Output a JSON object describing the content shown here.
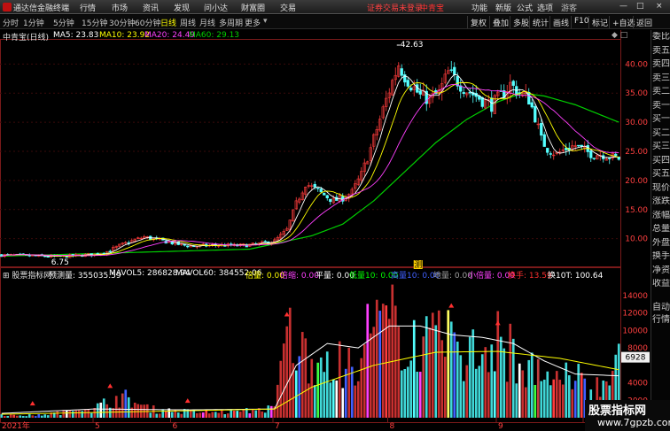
{
  "titlebar": {
    "app_name": "通达信金融终端",
    "menu": [
      "行情",
      "市场",
      "资讯",
      "发现",
      "问小达",
      "财富圈",
      "交易"
    ],
    "notice": "证券交易未登录",
    "stock_name": "中青宝",
    "right_menu": [
      "功能",
      "新版",
      "公式",
      "选项"
    ],
    "guest": "游客",
    "controls": [
      "—",
      "□",
      "×"
    ],
    "colors": {
      "notice": "#ff4040",
      "stock": "#ff3030"
    }
  },
  "toolbar": {
    "periods": [
      "分时",
      "1分钟",
      "5分钟",
      "15分钟",
      "30分钟",
      "60分钟",
      "日线",
      "周线",
      "月线",
      "多周期",
      "更多"
    ],
    "active_period": "日线",
    "tools": [
      "复权",
      "叠加",
      "多股",
      "统计",
      "画线",
      "F10",
      "标记",
      "+自选",
      "返回"
    ]
  },
  "price_panel": {
    "stock_label": "中青宝(日线)",
    "ma_legend": [
      {
        "label": "MA5: 23.83",
        "color": "#ffffff"
      },
      {
        "label": "MA10: 23.92",
        "color": "#ffff00"
      },
      {
        "label": "MA20: 24.49",
        "color": "#ff40ff"
      },
      {
        "label": "MA60: 29.13",
        "color": "#00d000"
      }
    ],
    "y_ticks": [
      "40.00",
      "35.00",
      "30.00",
      "25.00",
      "20.00",
      "15.00",
      "10.00"
    ],
    "high_label": "42.63",
    "low_label": "6.75",
    "marker_label": "测"
  },
  "volume_panel": {
    "title": "股票指标网",
    "legend": [
      {
        "label": "预测量: 355035.59",
        "color": "#ffffff"
      },
      {
        "label": "MAVOL5: 286828.94",
        "color": "#ffffff"
      },
      {
        "label": "MAVOL60: 384552.06",
        "color": "#ffffff"
      },
      {
        "label": "倍量: 0.00",
        "color": "#ffff00"
      },
      {
        "label": "倍缩: 0.00",
        "color": "#ff40ff"
      },
      {
        "label": "平量: 0.00",
        "color": "#ffffff"
      },
      {
        "label": "低量10: 0.00",
        "color": "#00ff00"
      },
      {
        "label": "高量10: 0.00",
        "color": "#4060ff"
      },
      {
        "label": "地量: 0.00",
        "color": "#a0a0a0"
      },
      {
        "label": "小倍量: 0.00",
        "color": "#ff40ff"
      },
      {
        "label": "换手: 13.59",
        "color": "#ff3030"
      },
      {
        "label": "换10T: 100.64",
        "color": "#ffffff"
      }
    ],
    "y_ticks": [
      "14000",
      "12000",
      "10000",
      "8000",
      "4000",
      "2000"
    ],
    "current_tag": "6928",
    "x_labels": [
      "2021年",
      "5",
      "6",
      "7",
      "8",
      "9",
      "10",
      "11",
      "12",
      "2",
      "3"
    ]
  },
  "sidebar": {
    "items": [
      "委比",
      "卖五",
      "卖四",
      "卖三",
      "卖二",
      "卖一",
      "买一",
      "买二",
      "买三",
      "买四",
      "买五",
      "现价",
      "涨跌",
      "涨幅",
      "总量",
      "外盘",
      "换手",
      "净资",
      "收益"
    ],
    "bottom": [
      "自动",
      "行情"
    ]
  },
  "watermark": {
    "line1": "股票指标网",
    "line2": "www.7gpzb.com"
  },
  "chart_data": {
    "type": "candlestick",
    "title": "中青宝(日线)",
    "price_ylim": [
      6,
      44
    ],
    "notable": {
      "high": 42.63,
      "low": 6.75
    },
    "price_path": [
      [
        0,
        7.2
      ],
      [
        6,
        7.1
      ],
      [
        12,
        7.0
      ],
      [
        18,
        6.9
      ],
      [
        24,
        7.1
      ],
      [
        30,
        7.3
      ],
      [
        34,
        7.8
      ],
      [
        38,
        8.8
      ],
      [
        42,
        9.6
      ],
      [
        46,
        10.3
      ],
      [
        50,
        9.8
      ],
      [
        54,
        9.4
      ],
      [
        58,
        8.9
      ],
      [
        62,
        8.7
      ],
      [
        66,
        8.8
      ],
      [
        70,
        8.9
      ],
      [
        76,
        8.8
      ],
      [
        82,
        9.0
      ],
      [
        88,
        9.6
      ],
      [
        92,
        11.5
      ],
      [
        95,
        16.0
      ],
      [
        98,
        19.5
      ],
      [
        101,
        18.5
      ],
      [
        104,
        17.5
      ],
      [
        107,
        16.5
      ],
      [
        110,
        17.0
      ],
      [
        113,
        18.0
      ],
      [
        116,
        21.0
      ],
      [
        119,
        25.5
      ],
      [
        122,
        30.5
      ],
      [
        125,
        35.5
      ],
      [
        128,
        40.0
      ],
      [
        130,
        38.0
      ],
      [
        132,
        36.5
      ],
      [
        135,
        34.5
      ],
      [
        138,
        34.0
      ],
      [
        141,
        35.0
      ],
      [
        144,
        38.5
      ],
      [
        147,
        37.0
      ],
      [
        150,
        35.5
      ],
      [
        153,
        34.5
      ],
      [
        156,
        33.5
      ],
      [
        158,
        33.0
      ],
      [
        161,
        34.5
      ],
      [
        164,
        36.5
      ],
      [
        167,
        35.0
      ],
      [
        170,
        34.0
      ],
      [
        172,
        31.0
      ],
      [
        174,
        27.0
      ],
      [
        176,
        25.5
      ],
      [
        179,
        24.5
      ],
      [
        182,
        25.5
      ],
      [
        185,
        26.0
      ],
      [
        188,
        25.0
      ],
      [
        191,
        24.5
      ],
      [
        194,
        24.5
      ],
      [
        197,
        24.0
      ],
      [
        199,
        23.8
      ]
    ],
    "ma60_path": [
      [
        0,
        7.0
      ],
      [
        40,
        7.6
      ],
      [
        80,
        8.2
      ],
      [
        100,
        10.5
      ],
      [
        110,
        12.5
      ],
      [
        120,
        16.5
      ],
      [
        130,
        21.5
      ],
      [
        140,
        26.5
      ],
      [
        150,
        30.5
      ],
      [
        160,
        33.5
      ],
      [
        168,
        35.0
      ],
      [
        175,
        34.5
      ],
      [
        185,
        33.0
      ],
      [
        199,
        30.0
      ]
    ],
    "volume_ylim": [
      0,
      15000
    ],
    "volume_profile": [
      [
        0,
        400
      ],
      [
        10,
        300
      ],
      [
        20,
        700
      ],
      [
        30,
        1200
      ],
      [
        35,
        2200
      ],
      [
        40,
        2800
      ],
      [
        45,
        1500
      ],
      [
        50,
        1000
      ],
      [
        60,
        800
      ],
      [
        70,
        700
      ],
      [
        80,
        900
      ],
      [
        88,
        1200
      ],
      [
        92,
        11000
      ],
      [
        95,
        9500
      ],
      [
        100,
        8500
      ],
      [
        105,
        6000
      ],
      [
        110,
        7000
      ],
      [
        115,
        8500
      ],
      [
        120,
        11500
      ],
      [
        125,
        12500
      ],
      [
        130,
        11000
      ],
      [
        135,
        10500
      ],
      [
        140,
        9000
      ],
      [
        145,
        12000
      ],
      [
        150,
        8000
      ],
      [
        155,
        9000
      ],
      [
        160,
        10000
      ],
      [
        165,
        8500
      ],
      [
        170,
        6000
      ],
      [
        175,
        5000
      ],
      [
        180,
        4500
      ],
      [
        185,
        5500
      ],
      [
        190,
        3500
      ],
      [
        195,
        4500
      ],
      [
        199,
        6928
      ]
    ],
    "mavol_path": [
      [
        0,
        500
      ],
      [
        30,
        1000
      ],
      [
        60,
        900
      ],
      [
        88,
        1000
      ],
      [
        95,
        6000
      ],
      [
        105,
        8500
      ],
      [
        115,
        8000
      ],
      [
        125,
        10500
      ],
      [
        135,
        10500
      ],
      [
        145,
        9500
      ],
      [
        155,
        9200
      ],
      [
        165,
        8500
      ],
      [
        175,
        6500
      ],
      [
        185,
        5000
      ],
      [
        199,
        4800
      ]
    ],
    "mavol60_path": [
      [
        0,
        400
      ],
      [
        60,
        800
      ],
      [
        88,
        1000
      ],
      [
        100,
        3500
      ],
      [
        120,
        6000
      ],
      [
        140,
        7500
      ],
      [
        160,
        7600
      ],
      [
        180,
        6800
      ],
      [
        199,
        5500
      ]
    ]
  }
}
